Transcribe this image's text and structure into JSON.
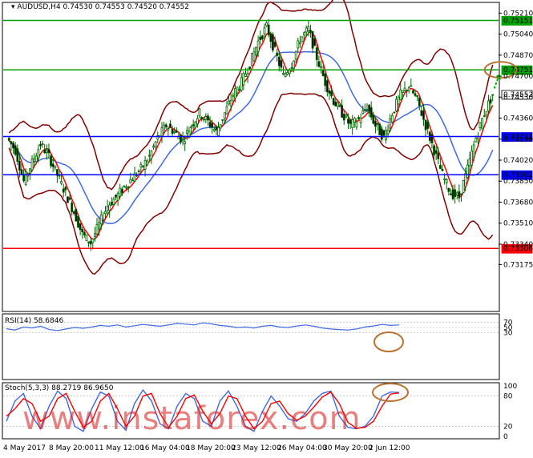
{
  "colors": {
    "up_candle": "#ffffff",
    "down_candle": "#000000",
    "candle_frame": "#006400",
    "bollinger": "#800000",
    "ma_fast": "#ff0000",
    "ma_slow": "#4169e1",
    "green_level": "#00a000",
    "blue_level": "#0000ff",
    "red_level": "#ff0000",
    "rsi_line": "#4169e1",
    "stoch_main": "#4169e1",
    "stoch_signal": "#ff0000",
    "annotation_circle": "#b87333",
    "annotation_arrow": "#00b000",
    "label_bg_green": "#00a000",
    "label_bg_blue": "#0000ff",
    "label_bg_red": "#ff0000",
    "current_price_bg": "#ffffff",
    "watermark": "#d41a1a"
  },
  "header": {
    "symbol_tf": "AUDUSD,H4",
    "ohlc": "0.74530 0.74553 0.74520 0.74552"
  },
  "rsi_panel": {
    "label": "RSI(14) 58.6846"
  },
  "stoch_panel": {
    "label": "Stoch(5,3,3) 88.2719 86.9650"
  },
  "watermark": {
    "text": "www.instaforex.com"
  },
  "chart_data": [
    {
      "type": "line",
      "title": "AUDUSD,H4",
      "ylim": [
        0.731,
        0.7529
      ],
      "y_ticks": [
        "0.75210",
        "0.75040",
        "0.74870",
        "0.74700",
        "0.74530",
        "0.74360",
        "0.74190",
        "0.74020",
        "0.73850",
        "0.73680",
        "0.73510",
        "0.73340",
        "0.73175"
      ],
      "x_tick_labels": [
        "4 May 2017",
        "8 May 20:00",
        "11 May 12:00",
        "16 May 04:00",
        "18 May 20:00",
        "23 May 12:00",
        "26 May 04:00",
        "30 May 20:00",
        "2 Jun 12:00"
      ],
      "levels": [
        {
          "label": "0.75151",
          "value": 0.75151,
          "color": "green"
        },
        {
          "label": "0.74751",
          "value": 0.74751,
          "color": "green"
        },
        {
          "label": "0.74552",
          "value": 0.74552,
          "color": "current"
        },
        {
          "label": "0.74211",
          "value": 0.74211,
          "color": "blue"
        },
        {
          "label": "0.73902",
          "value": 0.73902,
          "color": "blue"
        },
        {
          "label": "0.73306",
          "value": 0.73306,
          "color": "red"
        }
      ],
      "price_path": [
        0.742,
        0.741,
        0.7385,
        0.74,
        0.7415,
        0.7405,
        0.739,
        0.7375,
        0.736,
        0.7342,
        0.7335,
        0.735,
        0.7365,
        0.7372,
        0.738,
        0.7388,
        0.7395,
        0.7405,
        0.742,
        0.743,
        0.7425,
        0.7418,
        0.743,
        0.744,
        0.7433,
        0.7425,
        0.744,
        0.7455,
        0.7465,
        0.748,
        0.7498,
        0.751,
        0.749,
        0.747,
        0.748,
        0.75,
        0.7508,
        0.7485,
        0.7465,
        0.745,
        0.744,
        0.743,
        0.7435,
        0.7445,
        0.743,
        0.742,
        0.744,
        0.7455,
        0.7462,
        0.745,
        0.743,
        0.741,
        0.739,
        0.7375,
        0.7372,
        0.7395,
        0.742,
        0.744,
        0.7455
      ],
      "series": [
        {
          "name": "",
          "values": []
        }
      ]
    },
    {
      "type": "line",
      "title": "RSI(14) 58.6846",
      "ylim": [
        0,
        100
      ],
      "y_ticks": [
        "70",
        "50",
        "30"
      ],
      "values": [
        45,
        40,
        52,
        48,
        55,
        42,
        38,
        44,
        50,
        47,
        52,
        58,
        55,
        60,
        52,
        57,
        62,
        58,
        55,
        60,
        66,
        63,
        60,
        68,
        64,
        58,
        55,
        50,
        52,
        48,
        55,
        58,
        52,
        50,
        56,
        60,
        55,
        48,
        44,
        42,
        40,
        44,
        52,
        56,
        62,
        58,
        60
      ]
    },
    {
      "type": "line",
      "title": "Stoch(5,3,3) 88.2719 86.9650",
      "ylim": [
        0,
        100
      ],
      "y_ticks": [
        "100",
        "80",
        "20",
        "0"
      ],
      "series": [
        {
          "name": "",
          "values": [
            30,
            70,
            85,
            40,
            15,
            60,
            90,
            75,
            20,
            10,
            55,
            88,
            80,
            30,
            12,
            65,
            92,
            70,
            25,
            15,
            60,
            85,
            75,
            30,
            20,
            70,
            90,
            60,
            20,
            10,
            50,
            80,
            60,
            35,
            30,
            45,
            70,
            85,
            90,
            40,
            18,
            15,
            20,
            40,
            80,
            88,
            87
          ]
        },
        {
          "name": "",
          "values": [
            40,
            55,
            75,
            65,
            30,
            40,
            75,
            85,
            50,
            18,
            30,
            70,
            85,
            55,
            20,
            40,
            80,
            85,
            45,
            18,
            40,
            75,
            82,
            50,
            25,
            45,
            80,
            75,
            40,
            15,
            30,
            65,
            70,
            45,
            32,
            40,
            58,
            78,
            88,
            65,
            28,
            16,
            18,
            30,
            60,
            84,
            86
          ]
        }
      ]
    }
  ]
}
